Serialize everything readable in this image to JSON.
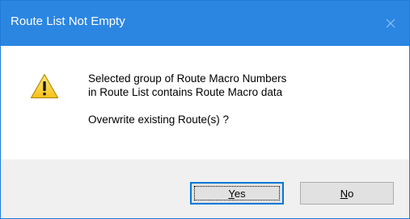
{
  "window": {
    "title": "Route List Not Empty",
    "accent_color": "#2b86e2"
  },
  "icon": {
    "name": "warning-icon"
  },
  "message": {
    "line1": "Selected group of Route Macro Numbers",
    "line2": "in Route List contains Route Macro data",
    "question": "Overwrite existing Route(s) ?"
  },
  "buttons": {
    "yes": {
      "mnemonic": "Y",
      "rest": "es"
    },
    "no": {
      "mnemonic": "N",
      "rest": "o"
    }
  }
}
